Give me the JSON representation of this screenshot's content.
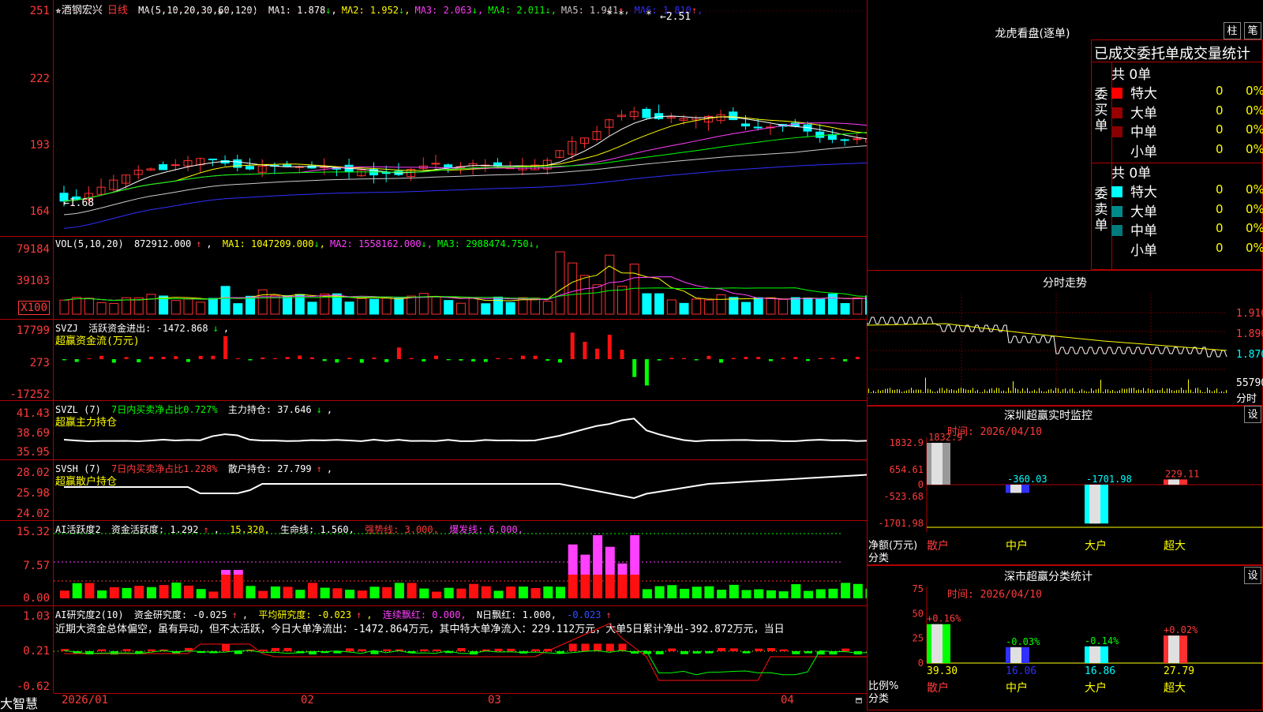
{
  "stock": {
    "star": "★",
    "name": "酒钢宏兴",
    "period": "日线"
  },
  "kline": {
    "ma_title": "MA(5,10,20,30,60,120)",
    "ma": [
      {
        "label": "MA1: 1.878",
        "arrow": "↓",
        "color": "#ffffff"
      },
      {
        "label": "MA2: 1.952",
        "arrow": "↓",
        "color": "#ffff00"
      },
      {
        "label": "MA3: 2.063",
        "arrow": "↓",
        "color": "#ff40ff"
      },
      {
        "label": "MA4: 2.011",
        "arrow": "↓",
        "color": "#00ff00"
      },
      {
        "label": "MA5: 1.941",
        "arrow": "↑",
        "color": "#cccccc"
      },
      {
        "label": "MA6: 1.810",
        "arrow": "↑",
        "color": "#3030ff"
      }
    ],
    "y_ticks": [
      "251",
      "222",
      "193",
      "164"
    ],
    "high_mark": "2.51",
    "low_mark": "1.68",
    "stars": [
      "*",
      "*",
      "*",
      "*"
    ]
  },
  "vol": {
    "title": "VOL(5,10,20)",
    "value": "872912.000",
    "value_arrow": "↑",
    "ma": [
      {
        "label": "MA1: 1047209.000",
        "arrow": "↓",
        "color": "#ffff00"
      },
      {
        "label": "MA2: 1558162.000",
        "arrow": "↓",
        "color": "#ff40ff"
      },
      {
        "label": "MA3: 2988474.750",
        "arrow": "↓",
        "color": "#00ff00"
      }
    ],
    "y_ticks": [
      "79184",
      "39103"
    ],
    "unit": "X100"
  },
  "svzj": {
    "title": "SVZJ",
    "line1": "活跃资金进出: -1472.868",
    "arrow": "↓",
    "tail": ",",
    "subtitle": "超赢资金流(万元)",
    "y_ticks": [
      "17799",
      "273",
      "-17252"
    ]
  },
  "svzl": {
    "title": "SVZL (7)",
    "part1": "7日内买卖净占比0.727%",
    "part2": "主力持仓: 37.646",
    "arrow": "↓",
    "tail": ",",
    "subtitle": "超赢主力持仓",
    "y_ticks": [
      "41.43",
      "38.69",
      "35.95"
    ]
  },
  "svsh": {
    "title": "SVSH (7)",
    "part1": "7日内买卖净占比1.228%",
    "part2": "散户持仓: 27.799",
    "arrow": "↑",
    "tail": ",",
    "subtitle": "超赢散户持仓",
    "y_ticks": [
      "28.02",
      "25.98",
      "24.02"
    ]
  },
  "ai_active": {
    "title": "AI活跃度2",
    "a": "资金活跃度: 1.292",
    "a_arrow": "↑",
    "b": "15.320,",
    "c": "生命线: 1.560,",
    "d": "强势线: 3.000,",
    "e": "爆发线: 6.000,",
    "y_ticks": [
      "15.32",
      "7.57",
      "0.00"
    ]
  },
  "ai_research": {
    "title": "AI研究度2(10)",
    "a": "资金研究度: -0.025",
    "a_arrow": "↑",
    "b": "平均研究度: -0.023",
    "b_arrow": "↑",
    "c": "连续飘红: 0.000,",
    "d": "N日飘红: 1.000,",
    "e": "-0.023",
    "e_arrow": "↑",
    "comment": "近期大资金总体偏空，虽有异动，但不太活跃，今日大单净流出：-1472.864万元，其中特大单净流入：229.112万元，大单5日累计净出-392.872万元，当日",
    "y_ticks": [
      "1.03",
      "0.21",
      "-0.62"
    ]
  },
  "x_axis": {
    "labels": [
      "2026/01",
      "02",
      "03",
      "04"
    ]
  },
  "brand": "大智慧",
  "side": {
    "top_title": "龙虎看盘(逐单)",
    "tab1": "柱",
    "tab2": "笔",
    "order_head": "已成交委托单成交量统计",
    "buy_label": "委买单",
    "sell_label": "委卖单",
    "buy_total": "共 0单",
    "sell_total": "共 0单",
    "rows": [
      {
        "name": "特大",
        "count": "0",
        "pct": "0%"
      },
      {
        "name": "大单",
        "count": "0",
        "pct": "0%"
      },
      {
        "name": "中单",
        "count": "0",
        "pct": "0%"
      },
      {
        "name": "小单",
        "count": "0",
        "pct": "0%"
      }
    ],
    "buy_colors": [
      "#ff0000",
      "#990000",
      "#880000",
      ""
    ],
    "sell_colors": [
      "#00ffff",
      "#008b8b",
      "#007a7a",
      ""
    ],
    "fenshi_title": "分时走势",
    "fenshi_y": [
      "1.910",
      "1.890",
      "1.870"
    ],
    "fenshi_vol": "55790",
    "fenshi_unit": "分时",
    "monitor_title": "深圳超赢实时监控",
    "set": "设",
    "monitor_time": "时间: 2026/04/10",
    "monitor_y": [
      "1832.9",
      "654.61",
      "0",
      "-523.68",
      "-1701.98"
    ],
    "monitor_axis": "净额(万元)",
    "monitor_cat_label": "分类",
    "monitor_vals": [
      "1832.9",
      "-360.03",
      "-1701.98",
      "229.11"
    ],
    "cats": [
      "散户",
      "中户",
      "大户",
      "超大"
    ],
    "stat_title": "深市超赢分类统计",
    "stat_time": "时间: 2026/04/10",
    "stat_y": [
      "75",
      "50",
      "25",
      "0"
    ],
    "stat_axis": "比例%",
    "stat_cat_label": "分类",
    "stat_changes": [
      "+0.16%",
      "-0.03%",
      "-0.14%",
      "+0.02%"
    ],
    "stat_vals": [
      "39.30",
      "16.06",
      "16.86",
      "27.79"
    ]
  }
}
